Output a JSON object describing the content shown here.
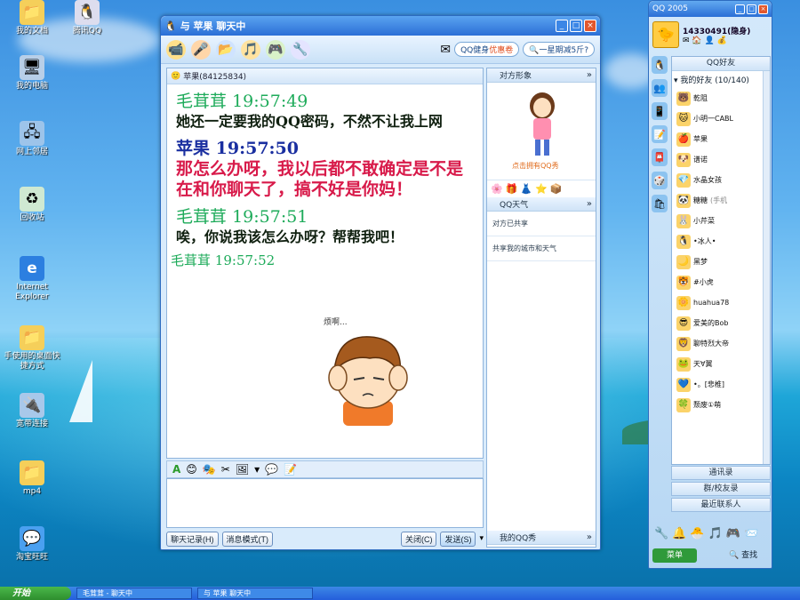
{
  "desktop": {
    "icons": [
      {
        "label": "我的文档",
        "icon": "folder-icon"
      },
      {
        "label": "腾讯QQ",
        "icon": "qq-icon"
      },
      {
        "label": "我的电脑",
        "icon": "computer-icon"
      },
      {
        "label": "网上邻居",
        "icon": "network-icon"
      },
      {
        "label": "回收站",
        "icon": "recycle-bin-icon"
      },
      {
        "label": "Internet Explorer",
        "icon": "ie-icon"
      },
      {
        "label": "手使用的桌面快捷方式",
        "icon": "folder-icon"
      },
      {
        "label": "宽带连接",
        "icon": "broadband-icon"
      },
      {
        "label": "mp4",
        "icon": "folder-icon"
      },
      {
        "label": "淘宝旺旺",
        "icon": "wangwang-icon"
      }
    ]
  },
  "chat_window": {
    "title": "与 苹果 聊天中",
    "ad_text": "QQ健身",
    "ad_highlight": "优惠卷",
    "search_placeholder": "一星期减5斤?",
    "contact_line": "苹果(84125834)",
    "messages": [
      {
        "sender": "毛茸茸",
        "time": "19:57:49",
        "text": "她还一定要我的QQ密码，不然不让我上网"
      },
      {
        "sender": "苹果",
        "time": "19:57:50",
        "text": "那怎么办呀，我以后都不敢确定是不是在和你聊天了，搞不好是你妈！"
      },
      {
        "sender": "毛茸茸",
        "time": "19:57:51",
        "text": "唉，你说我该怎么办呀？帮帮我吧！"
      },
      {
        "sender": "毛茸茸",
        "time": "19:57:52",
        "text": ""
      }
    ],
    "cartoon_caption": "烦啊...",
    "buttons": {
      "history": "聊天记录(H)",
      "mode": "消息模式(T)",
      "close": "关闭(C)",
      "send": "发送(S)"
    },
    "side": {
      "show_header": "对方形象",
      "show_link": "点击拥有QQ秀",
      "weather_header": "QQ天气",
      "weather_status": "对方已共享",
      "weather_share": "共享我的城市和天气",
      "my_show": "我的QQ秀"
    }
  },
  "qq_panel": {
    "title": "QQ 2005",
    "user_number": "14330491(隐身)",
    "tab_label": "QQ好友",
    "group": "我的好友 (10/140)",
    "friends": [
      {
        "name": "乾阻",
        "tag": ""
      },
      {
        "name": "小明一CABL",
        "tag": ""
      },
      {
        "name": "苹果",
        "tag": ""
      },
      {
        "name": "谱诺",
        "tag": ""
      },
      {
        "name": "水晶女孩",
        "tag": ""
      },
      {
        "name": "糖糖",
        "tag": "(手机"
      },
      {
        "name": "小芹菜",
        "tag": ""
      },
      {
        "name": "•冰人•",
        "tag": ""
      },
      {
        "name": "黑梦",
        "tag": ""
      },
      {
        "name": "#小虎",
        "tag": ""
      },
      {
        "name": "huahua78",
        "tag": ""
      },
      {
        "name": "爱美的Bob",
        "tag": ""
      },
      {
        "name": "聊特烈大帝",
        "tag": ""
      },
      {
        "name": "天∀翼",
        "tag": ""
      },
      {
        "name": "•。[悲椎]",
        "tag": ""
      },
      {
        "name": "颓废①萌",
        "tag": ""
      }
    ],
    "sections": [
      "通讯录",
      "群/校友录",
      "最近联系人"
    ],
    "menu_label": "菜单",
    "find_label": "查找"
  },
  "taskbar": {
    "start": "开始",
    "items": [
      "毛茸茸 - 聊天中",
      "与 苹果 聊天中"
    ]
  }
}
